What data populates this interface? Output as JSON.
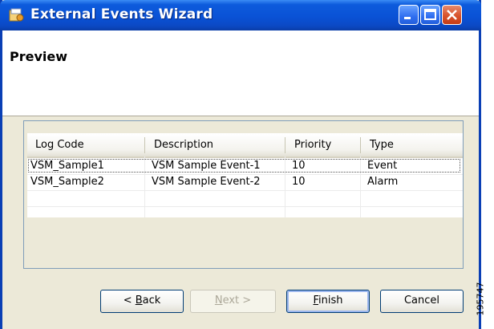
{
  "window": {
    "title": "External Events Wizard"
  },
  "header": {
    "title": "Preview"
  },
  "table": {
    "columns": [
      "Log Code",
      "Description",
      "Priority",
      "Type"
    ],
    "rows": [
      [
        "VSM_Sample1",
        "VSM Sample Event-1",
        "10",
        "Event"
      ],
      [
        "VSM_Sample2",
        "VSM Sample Event-2",
        "10",
        "Alarm"
      ]
    ]
  },
  "buttons": {
    "back_pre": "< ",
    "back_u": "B",
    "back_post": "ack",
    "next_u": "N",
    "next_post": "ext >",
    "finish_u": "F",
    "finish_post": "inish",
    "cancel": "Cancel"
  },
  "figure_code": "195747",
  "colors": {
    "titlebar": "#0a52d6",
    "close_button": "#d8532c",
    "window_bg": "#ece9d8"
  },
  "icons": [
    "app-icon",
    "minimize-icon",
    "maximize-icon",
    "close-icon"
  ]
}
